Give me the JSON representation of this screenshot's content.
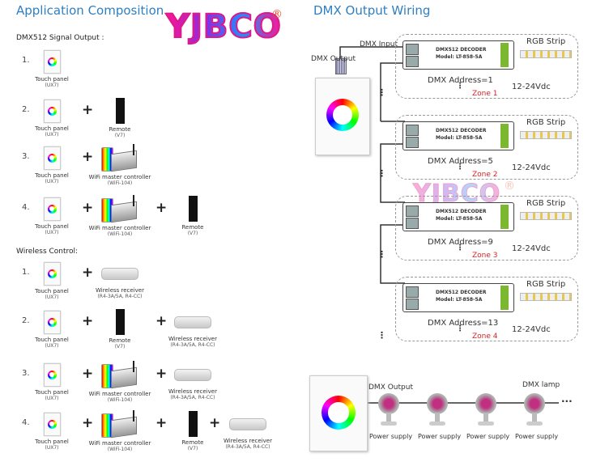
{
  "left": {
    "title": "Application Composition",
    "dmx_heading": "DMX512 Signal Output :",
    "wireless_heading": "Wireless Control:",
    "dmx_rows": [
      {
        "num": "1.",
        "items": [
          {
            "type": "panel",
            "name": "Touch panel",
            "model": "(UX7)"
          }
        ]
      },
      {
        "num": "2.",
        "items": [
          {
            "type": "panel",
            "name": "Touch panel",
            "model": "(UX7)"
          },
          {
            "type": "remote",
            "name": "Remote",
            "model": "(V7)"
          }
        ]
      },
      {
        "num": "3.",
        "items": [
          {
            "type": "panel",
            "name": "Touch panel",
            "model": "(UX7)"
          },
          {
            "type": "controller",
            "name": "WiFi master controller",
            "model": "(WiFi-104)"
          }
        ]
      },
      {
        "num": "4.",
        "items": [
          {
            "type": "panel",
            "name": "Touch panel",
            "model": "(UX7)"
          },
          {
            "type": "controller",
            "name": "WiFi master controller",
            "model": "(WiFi-104)"
          },
          {
            "type": "remote",
            "name": "Remote",
            "model": "(V7)"
          }
        ]
      }
    ],
    "wireless_rows": [
      {
        "num": "1.",
        "items": [
          {
            "type": "panel",
            "name": "Touch panel",
            "model": "(UX7)"
          },
          {
            "type": "receiver",
            "name": "Wireless receiver",
            "model": "(R4-3A/5A, R4-CC)"
          }
        ]
      },
      {
        "num": "2.",
        "items": [
          {
            "type": "panel",
            "name": "Touch panel",
            "model": "(UX7)"
          },
          {
            "type": "remote",
            "name": "Remote",
            "model": "(V7)"
          },
          {
            "type": "receiver",
            "name": "Wireless receiver",
            "model": "(R4-3A/5A, R4-CC)"
          }
        ]
      },
      {
        "num": "3.",
        "items": [
          {
            "type": "panel",
            "name": "Touch panel",
            "model": "(UX7)"
          },
          {
            "type": "controller",
            "name": "WiFi master controller",
            "model": "(WiFi-104)"
          },
          {
            "type": "receiver",
            "name": "Wireless receiver",
            "model": "(R4-3A/5A, R4-CC)"
          }
        ]
      },
      {
        "num": "4.",
        "items": [
          {
            "type": "panel",
            "name": "Touch panel",
            "model": "(UX7)"
          },
          {
            "type": "controller",
            "name": "WiFi master controller",
            "model": "(WiFi-104)"
          },
          {
            "type": "remote",
            "name": "Remote",
            "model": "(V7)"
          },
          {
            "type": "receiver",
            "name": "Wireless receiver",
            "model": "(R4-3A/5A, R4-CC)"
          }
        ]
      }
    ],
    "plus": "+"
  },
  "logo": {
    "text": "YJBCO",
    "mark": "®"
  },
  "right": {
    "title": "DMX Output Wiring",
    "dmx_output": "DMX Output",
    "dmx_input": "DMX Input",
    "zones": [
      {
        "decoder": "DMX512 DECODER",
        "model": "Model: LT-858-5A",
        "strip": "RGB Strip",
        "address": "DMX Address=1",
        "zone": "Zone 1",
        "voltage": "12-24Vdc"
      },
      {
        "decoder": "DMX512 DECODER",
        "model": "Model: LT-858-5A",
        "strip": "RGB Strip",
        "address": "DMX Address=5",
        "zone": "Zone 2",
        "voltage": "12-24Vdc"
      },
      {
        "decoder": "DMX512 DECODER",
        "model": "Model: LT-858-5A",
        "strip": "RGB Strip",
        "address": "DMX Address=9",
        "zone": "Zone 3",
        "voltage": "12-24Vdc"
      },
      {
        "decoder": "DMX512 DECODER",
        "model": "Model: LT-858-5A",
        "strip": "RGB Strip",
        "address": "DMX Address=13",
        "zone": "Zone 4",
        "voltage": "12-24Vdc"
      }
    ],
    "lamp_section": {
      "dmx_output": "DMX Output",
      "dmx_lamp": "DMX lamp",
      "power_supply": "Power supply",
      "ellipsis": "..."
    }
  },
  "colors": {
    "title_blue": "#2f7fc1",
    "zone_red": "#dd2222",
    "terminal_green": "#7cb82f"
  }
}
